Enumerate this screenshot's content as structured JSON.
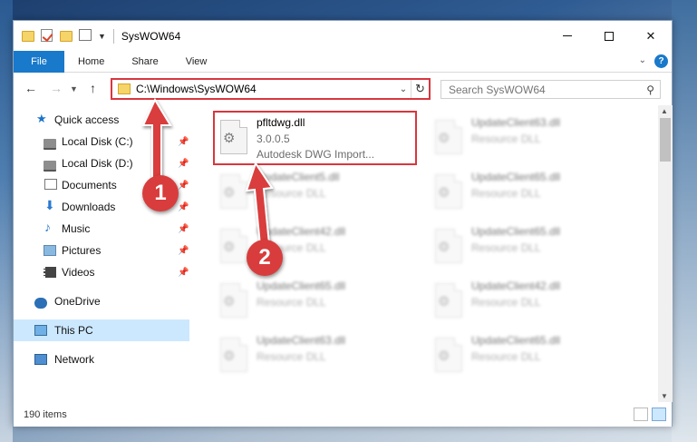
{
  "window": {
    "title": "SysWOW64",
    "controls": {
      "minimize": "–",
      "maximize": "□",
      "close": "✕"
    }
  },
  "ribbon": {
    "tabs": [
      "File",
      "Home",
      "Share",
      "View"
    ],
    "help": "?"
  },
  "address": {
    "path": "C:\\Windows\\SysWOW64",
    "dropdown_icon": "chevron-down-icon",
    "refresh_icon": "refresh-icon"
  },
  "search": {
    "placeholder": "Search SysWOW64"
  },
  "sidebar": {
    "items": [
      {
        "label": "Quick access",
        "icon": "star-icon",
        "pinned": false
      },
      {
        "label": "Local Disk (C:)",
        "icon": "disk-icon",
        "pinned": true
      },
      {
        "label": "Local Disk (D:)",
        "icon": "disk-icon",
        "pinned": true
      },
      {
        "label": "Documents",
        "icon": "documents-icon",
        "pinned": true
      },
      {
        "label": "Downloads",
        "icon": "downloads-icon",
        "pinned": true
      },
      {
        "label": "Music",
        "icon": "music-icon",
        "pinned": true
      },
      {
        "label": "Pictures",
        "icon": "pictures-icon",
        "pinned": true
      },
      {
        "label": "Videos",
        "icon": "videos-icon",
        "pinned": true
      },
      {
        "label": "OneDrive",
        "icon": "onedrive-icon",
        "pinned": false
      },
      {
        "label": "This PC",
        "icon": "this-pc-icon",
        "pinned": false,
        "selected": true
      },
      {
        "label": "Network",
        "icon": "network-icon",
        "pinned": false
      }
    ]
  },
  "files": [
    {
      "name": "pfltdwg.dll",
      "line2": "3.0.0.5",
      "line3": "Autodesk DWG Import...",
      "highlighted": true
    },
    {
      "name": "UpdateClient63.dll",
      "line2": "Resource DLL"
    },
    {
      "name": "UpdateClient5.dll",
      "line2": "Resource DLL"
    },
    {
      "name": "UpdateClient65.dll",
      "line2": "Resource DLL"
    },
    {
      "name": "UpdateClient42.dll",
      "line2": "Resource DLL"
    },
    {
      "name": "UpdateClient65.dll",
      "line2": "Resource DLL"
    },
    {
      "name": "UpdateClient65.dll",
      "line2": "Resource DLL"
    },
    {
      "name": "UpdateClient42.dll",
      "line2": "Resource DLL"
    },
    {
      "name": "UpdateClient63.dll",
      "line2": "Resource DLL"
    },
    {
      "name": "UpdateClient65.dll",
      "line2": "Resource DLL"
    }
  ],
  "status": {
    "item_count": "190 items"
  },
  "callouts": [
    "1",
    "2"
  ],
  "colors": {
    "accent": "#1979ca",
    "highlight_red": "#d9363e",
    "selection": "#cce8ff"
  }
}
